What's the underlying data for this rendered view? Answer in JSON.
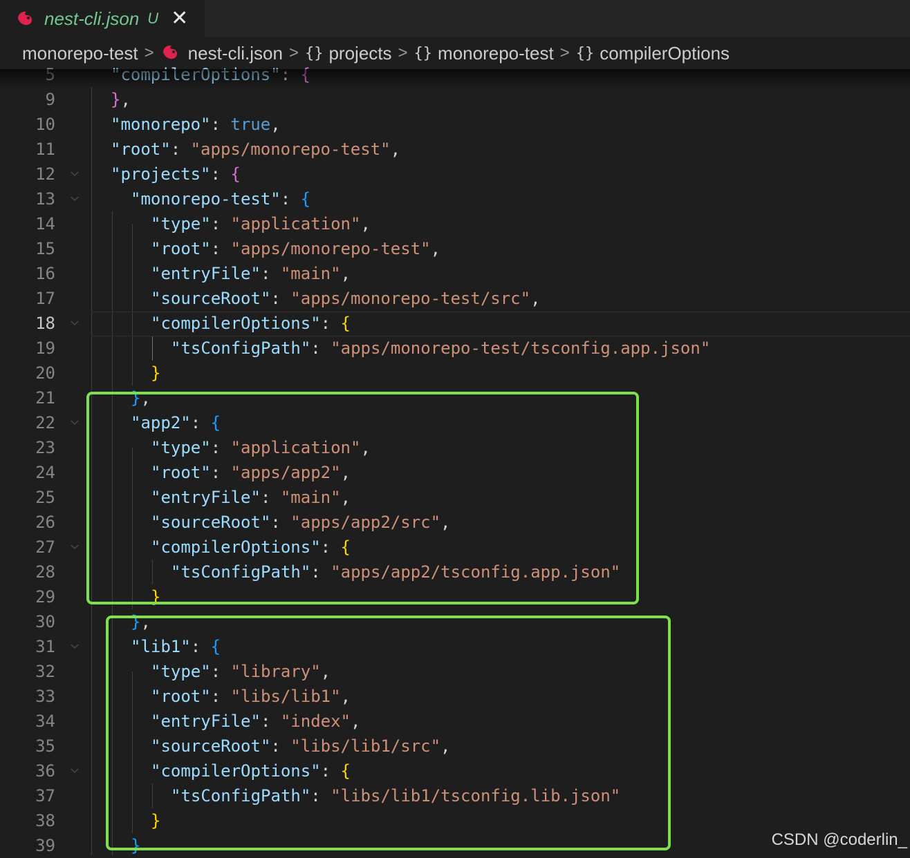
{
  "tab": {
    "title": "nest-cli.json",
    "badge": "U",
    "close": "✕"
  },
  "breadcrumb": {
    "items": [
      {
        "label": "monorepo-test"
      },
      {
        "label": "nest-cli.json",
        "icon": "nestjs-icon"
      },
      {
        "label": "projects",
        "icon": "braces-icon"
      },
      {
        "label": "monorepo-test",
        "icon": "braces-icon"
      },
      {
        "label": "compilerOptions",
        "icon": "braces-icon"
      }
    ],
    "separator": ">",
    "braces": "{}"
  },
  "editor": {
    "active_line": 18,
    "lines": [
      {
        "n": "5",
        "indent": 0,
        "tokens": [
          [
            "k",
            "\"compilerOptions\""
          ],
          [
            "p",
            ": "
          ],
          [
            "br2",
            "{"
          ]
        ]
      },
      {
        "n": "9",
        "indent": 0,
        "tokens": [
          [
            "br2",
            "}"
          ],
          [
            "p",
            ","
          ]
        ]
      },
      {
        "n": "10",
        "indent": 0,
        "tokens": [
          [
            "k",
            "\"monorepo\""
          ],
          [
            "p",
            ": "
          ],
          [
            "b",
            "true"
          ],
          [
            "p",
            ","
          ]
        ]
      },
      {
        "n": "11",
        "indent": 0,
        "tokens": [
          [
            "k",
            "\"root\""
          ],
          [
            "p",
            ": "
          ],
          [
            "s",
            "\"apps/monorepo-test\""
          ],
          [
            "p",
            ","
          ]
        ]
      },
      {
        "n": "12",
        "indent": 0,
        "fold": true,
        "tokens": [
          [
            "k",
            "\"projects\""
          ],
          [
            "p",
            ": "
          ],
          [
            "br2",
            "{"
          ]
        ]
      },
      {
        "n": "13",
        "indent": 1,
        "fold": true,
        "tokens": [
          [
            "k",
            "\"monorepo-test\""
          ],
          [
            "p",
            ": "
          ],
          [
            "br3",
            "{"
          ]
        ]
      },
      {
        "n": "14",
        "indent": 2,
        "tokens": [
          [
            "k",
            "\"type\""
          ],
          [
            "p",
            ": "
          ],
          [
            "s",
            "\"application\""
          ],
          [
            "p",
            ","
          ]
        ]
      },
      {
        "n": "15",
        "indent": 2,
        "tokens": [
          [
            "k",
            "\"root\""
          ],
          [
            "p",
            ": "
          ],
          [
            "s",
            "\"apps/monorepo-test\""
          ],
          [
            "p",
            ","
          ]
        ]
      },
      {
        "n": "16",
        "indent": 2,
        "tokens": [
          [
            "k",
            "\"entryFile\""
          ],
          [
            "p",
            ": "
          ],
          [
            "s",
            "\"main\""
          ],
          [
            "p",
            ","
          ]
        ]
      },
      {
        "n": "17",
        "indent": 2,
        "tokens": [
          [
            "k",
            "\"sourceRoot\""
          ],
          [
            "p",
            ": "
          ],
          [
            "s",
            "\"apps/monorepo-test/src\""
          ],
          [
            "p",
            ","
          ]
        ]
      },
      {
        "n": "18",
        "indent": 2,
        "fold": true,
        "tokens": [
          [
            "k",
            "\"compilerOptions\""
          ],
          [
            "p",
            ": "
          ],
          [
            "br1",
            "{"
          ]
        ]
      },
      {
        "n": "19",
        "indent": 3,
        "tokens": [
          [
            "k",
            "\"tsConfigPath\""
          ],
          [
            "p",
            ": "
          ],
          [
            "s",
            "\"apps/monorepo-test/tsconfig.app.json\""
          ]
        ]
      },
      {
        "n": "20",
        "indent": 2,
        "tokens": [
          [
            "br1",
            "}"
          ]
        ]
      },
      {
        "n": "21",
        "indent": 1,
        "tokens": [
          [
            "br3",
            "}"
          ],
          [
            "p",
            ","
          ]
        ]
      },
      {
        "n": "22",
        "indent": 1,
        "fold": true,
        "tokens": [
          [
            "k",
            "\"app2\""
          ],
          [
            "p",
            ": "
          ],
          [
            "br3",
            "{"
          ]
        ]
      },
      {
        "n": "23",
        "indent": 2,
        "tokens": [
          [
            "k",
            "\"type\""
          ],
          [
            "p",
            ": "
          ],
          [
            "s",
            "\"application\""
          ],
          [
            "p",
            ","
          ]
        ]
      },
      {
        "n": "24",
        "indent": 2,
        "tokens": [
          [
            "k",
            "\"root\""
          ],
          [
            "p",
            ": "
          ],
          [
            "s",
            "\"apps/app2\""
          ],
          [
            "p",
            ","
          ]
        ]
      },
      {
        "n": "25",
        "indent": 2,
        "tokens": [
          [
            "k",
            "\"entryFile\""
          ],
          [
            "p",
            ": "
          ],
          [
            "s",
            "\"main\""
          ],
          [
            "p",
            ","
          ]
        ]
      },
      {
        "n": "26",
        "indent": 2,
        "tokens": [
          [
            "k",
            "\"sourceRoot\""
          ],
          [
            "p",
            ": "
          ],
          [
            "s",
            "\"apps/app2/src\""
          ],
          [
            "p",
            ","
          ]
        ]
      },
      {
        "n": "27",
        "indent": 2,
        "fold": true,
        "tokens": [
          [
            "k",
            "\"compilerOptions\""
          ],
          [
            "p",
            ": "
          ],
          [
            "br1",
            "{"
          ]
        ]
      },
      {
        "n": "28",
        "indent": 3,
        "tokens": [
          [
            "k",
            "\"tsConfigPath\""
          ],
          [
            "p",
            ": "
          ],
          [
            "s",
            "\"apps/app2/tsconfig.app.json\""
          ]
        ]
      },
      {
        "n": "29",
        "indent": 2,
        "tokens": [
          [
            "br1",
            "}"
          ]
        ]
      },
      {
        "n": "30",
        "indent": 1,
        "tokens": [
          [
            "br3",
            "}"
          ],
          [
            "p",
            ","
          ]
        ]
      },
      {
        "n": "31",
        "indent": 1,
        "fold": true,
        "tokens": [
          [
            "k",
            "\"lib1\""
          ],
          [
            "p",
            ": "
          ],
          [
            "br3",
            "{"
          ]
        ]
      },
      {
        "n": "32",
        "indent": 2,
        "tokens": [
          [
            "k",
            "\"type\""
          ],
          [
            "p",
            ": "
          ],
          [
            "s",
            "\"library\""
          ],
          [
            "p",
            ","
          ]
        ]
      },
      {
        "n": "33",
        "indent": 2,
        "tokens": [
          [
            "k",
            "\"root\""
          ],
          [
            "p",
            ": "
          ],
          [
            "s",
            "\"libs/lib1\""
          ],
          [
            "p",
            ","
          ]
        ]
      },
      {
        "n": "34",
        "indent": 2,
        "tokens": [
          [
            "k",
            "\"entryFile\""
          ],
          [
            "p",
            ": "
          ],
          [
            "s",
            "\"index\""
          ],
          [
            "p",
            ","
          ]
        ]
      },
      {
        "n": "35",
        "indent": 2,
        "tokens": [
          [
            "k",
            "\"sourceRoot\""
          ],
          [
            "p",
            ": "
          ],
          [
            "s",
            "\"libs/lib1/src\""
          ],
          [
            "p",
            ","
          ]
        ]
      },
      {
        "n": "36",
        "indent": 2,
        "fold": true,
        "tokens": [
          [
            "k",
            "\"compilerOptions\""
          ],
          [
            "p",
            ": "
          ],
          [
            "br1",
            "{"
          ]
        ]
      },
      {
        "n": "37",
        "indent": 3,
        "tokens": [
          [
            "k",
            "\"tsConfigPath\""
          ],
          [
            "p",
            ": "
          ],
          [
            "s",
            "\"libs/lib1/tsconfig.lib.json\""
          ]
        ]
      },
      {
        "n": "38",
        "indent": 2,
        "tokens": [
          [
            "br1",
            "}"
          ]
        ]
      },
      {
        "n": "39",
        "indent": 1,
        "tokens": [
          [
            "br3",
            "}"
          ]
        ]
      }
    ]
  },
  "colors": {
    "highlight_box": "#7ee04a",
    "key": "#9cdcfe",
    "string": "#ce9178",
    "boolean": "#569cd6",
    "bracket_gold": "#ffd700",
    "bracket_orchid": "#da70d6",
    "bracket_blue": "#179fff",
    "modified_green": "#73c991"
  },
  "watermark": "CSDN @coderlin_"
}
